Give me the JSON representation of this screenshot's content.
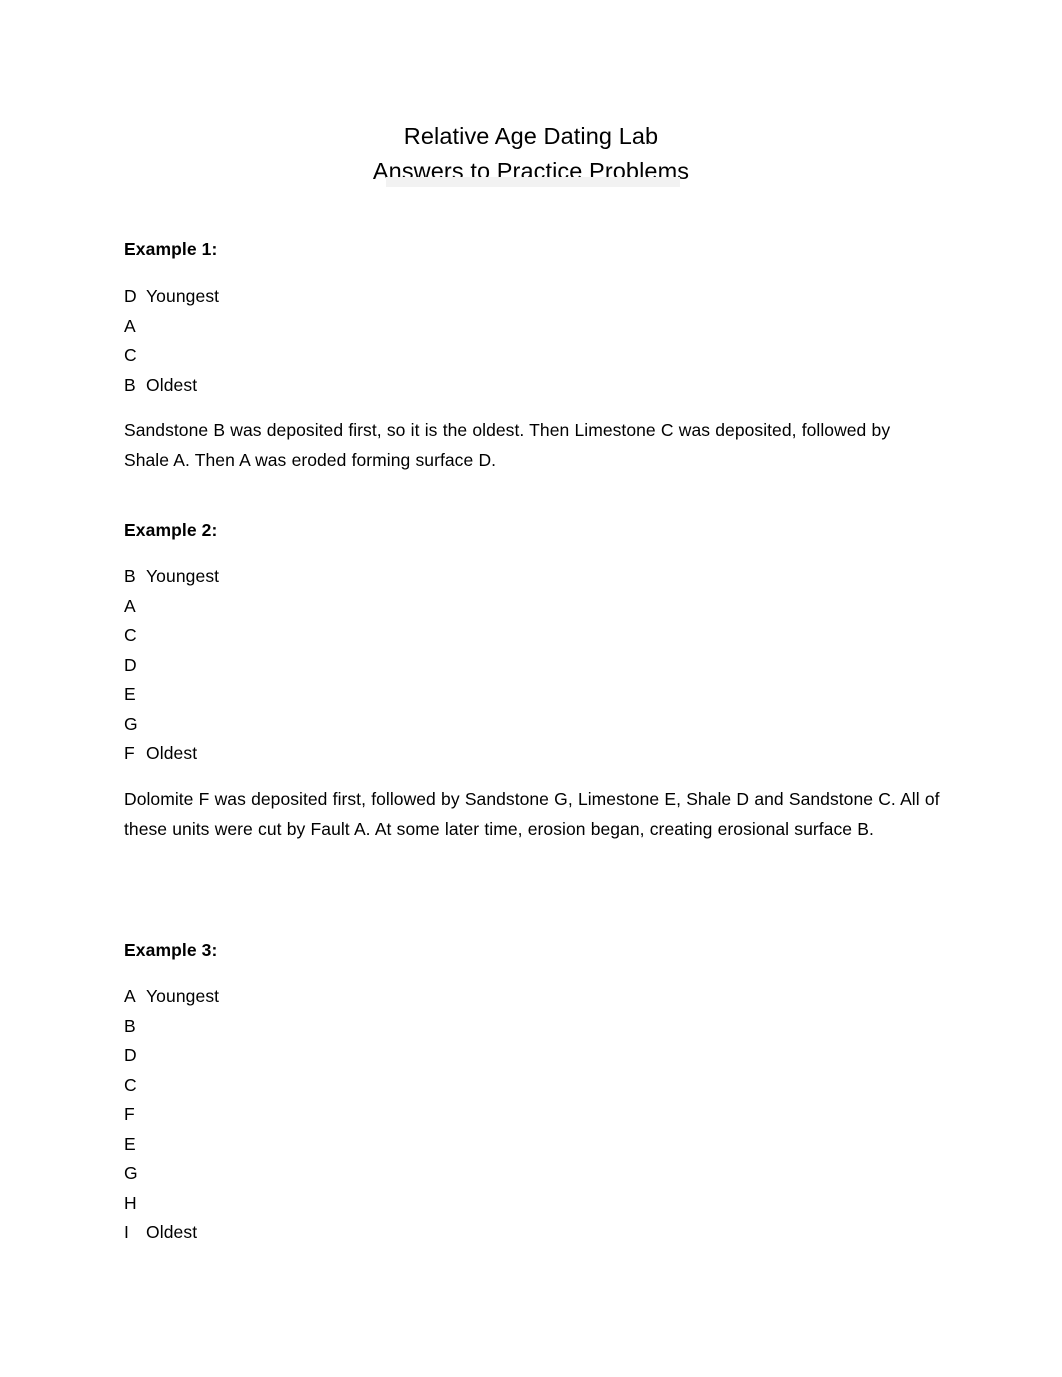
{
  "document": {
    "title_line_1": "Relative Age Dating Lab",
    "title_line_2": "Answers to Practice Problems"
  },
  "sections": [
    {
      "heading": "Example 1:",
      "sequence": [
        {
          "letter": "D",
          "label": "Youngest"
        },
        {
          "letter": "A",
          "label": ""
        },
        {
          "letter": "C",
          "label": ""
        },
        {
          "letter": "B",
          "label": "Oldest"
        }
      ],
      "explanation": "Sandstone B was deposited first, so it is the oldest.  Then Limestone C was deposited, followed by Shale A.  Then A was eroded forming surface D."
    },
    {
      "heading": "Example 2:",
      "sequence": [
        {
          "letter": "B",
          "label": "Youngest"
        },
        {
          "letter": "A",
          "label": ""
        },
        {
          "letter": "C",
          "label": ""
        },
        {
          "letter": "D",
          "label": ""
        },
        {
          "letter": "E",
          "label": ""
        },
        {
          "letter": "G",
          "label": ""
        },
        {
          "letter": "F",
          "label": "Oldest"
        }
      ],
      "explanation": "Dolomite F was deposited first, followed by Sandstone G, Limestone E, Shale D and Sandstone C. All of these units were cut by Fault A.   At some later time, erosion began, creating erosional surface B."
    },
    {
      "heading": "Example 3:",
      "sequence": [
        {
          "letter": "A",
          "label": "Youngest"
        },
        {
          "letter": "B",
          "label": ""
        },
        {
          "letter": "D",
          "label": ""
        },
        {
          "letter": "C",
          "label": ""
        },
        {
          "letter": "F",
          "label": ""
        },
        {
          "letter": "E",
          "label": ""
        },
        {
          "letter": "G",
          "label": ""
        },
        {
          "letter": "H",
          "label": ""
        },
        {
          "letter": "I",
          "label": "Oldest"
        }
      ],
      "explanation": ""
    }
  ],
  "colors": {
    "page_background": "#ffffff",
    "text": "#000000",
    "highlight_band": "#f2f2f2"
  }
}
